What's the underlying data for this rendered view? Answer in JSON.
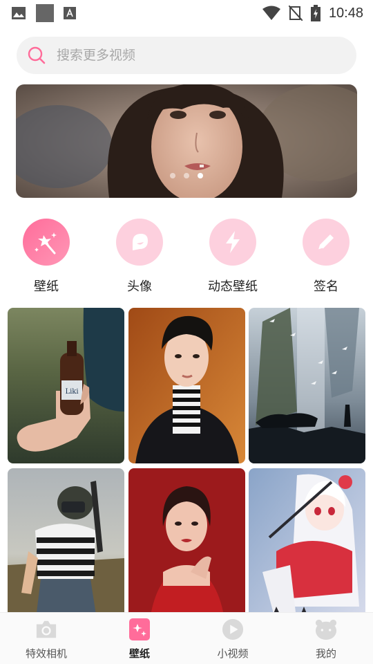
{
  "status_bar": {
    "time": "10:48",
    "icons": [
      "image-icon",
      "square-icon",
      "a-icon",
      "wifi-icon",
      "no-signal-icon",
      "battery-icon"
    ]
  },
  "search": {
    "placeholder": "搜索更多视频",
    "icon": "search-icon"
  },
  "banner": {
    "slide_count": 3,
    "active_slide": 3
  },
  "categories": [
    {
      "label": "壁纸",
      "icon": "magic-wand-icon",
      "active": true
    },
    {
      "label": "头像",
      "icon": "chat-bubble-icon",
      "active": false
    },
    {
      "label": "动态壁纸",
      "icon": "lightning-icon",
      "active": false
    },
    {
      "label": "签名",
      "icon": "pencil-icon",
      "active": false
    }
  ],
  "wallpapers": [
    {
      "name": "hand-with-bottle",
      "bottle_label": "Liki"
    },
    {
      "name": "young-man-striped-turtleneck"
    },
    {
      "name": "panther-and-boy-waterfall"
    },
    {
      "name": "soldier-with-helmet"
    },
    {
      "name": "woman-in-red-dress"
    },
    {
      "name": "anime-girl-kimono"
    }
  ],
  "tab_bar": {
    "tabs": [
      {
        "label": "特效相机",
        "icon": "camera-icon",
        "active": false
      },
      {
        "label": "壁纸",
        "icon": "sparkle-card-icon",
        "active": true
      },
      {
        "label": "小视频",
        "icon": "play-circle-icon",
        "active": false
      },
      {
        "label": "我的",
        "icon": "bear-face-icon",
        "active": false
      }
    ]
  },
  "colors": {
    "accent": "#ff6c9a",
    "accent_light": "#fdd0de",
    "search_bg": "#f2f2f2",
    "tab_inactive": "#d9d9d9"
  }
}
